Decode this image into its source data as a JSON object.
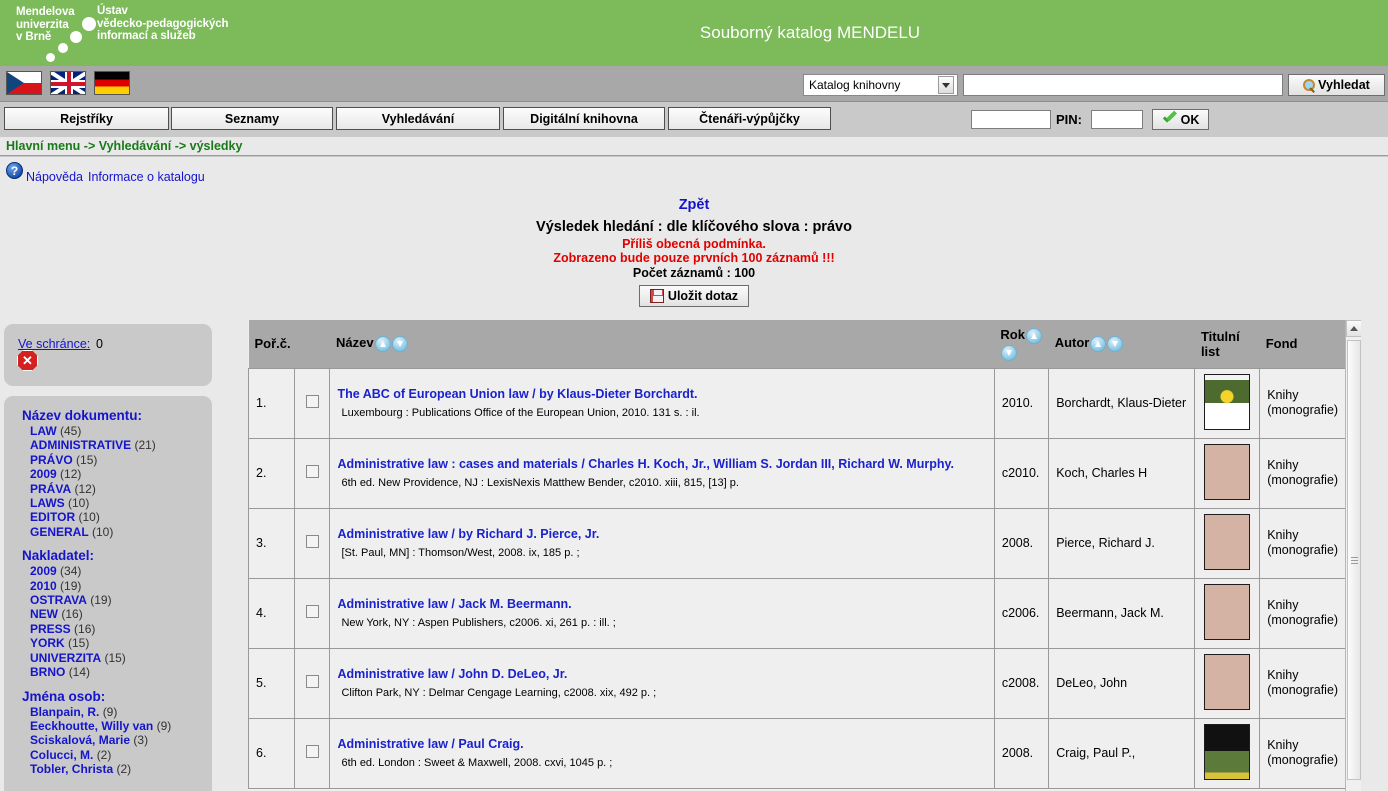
{
  "banner": {
    "logo_line1": "Mendelova\nuniverzita\nv Brně",
    "logo_line2": "Ústav\nvědecko-pedagogických\ninformací a služeb",
    "title": "Souborný katalog MENDELU"
  },
  "toolbar": {
    "flags": [
      "cz-flag-icon",
      "uk-flag-icon",
      "de-flag-icon"
    ],
    "search_scope_selected": "Katalog knihovny",
    "search_value": "",
    "search_placeholder": "",
    "search_button": "Vyhledat",
    "search_icon": "magnifier-icon",
    "user_value": "",
    "pin_label": "PIN:",
    "pin_value": "",
    "ok_button": "OK",
    "ok_icon": "check-icon"
  },
  "nav": {
    "items": [
      {
        "label": "Rejstříky"
      },
      {
        "label": "Seznamy"
      },
      {
        "label": "Vyhledávání"
      },
      {
        "label": "Digitální knihovna"
      },
      {
        "label": "Čtenáři-výpůjčky"
      }
    ]
  },
  "breadcrumb": {
    "text": "Hlavní menu -> Vyhledávání -> výsledky"
  },
  "help": {
    "icon": "question-mark-icon",
    "glyph": "?",
    "link1": "Nápověda",
    "link2": "Informace o katalogu"
  },
  "result_header": {
    "back_link": "Zpět",
    "title": "Výsledek hledání : dle klíčového slova : právo",
    "warning1": "Příliš obecná podmínka.",
    "warning2": "Zobrazeno bude pouze prvních 100 záznamů !!!",
    "count": "Počet záznamů : 100",
    "save_button": "Uložit dotaz",
    "save_icon": "floppy-disk-icon"
  },
  "clipboard": {
    "label": "Ve schránce:",
    "count": "0",
    "clear_icon": "red-x-delete-icon",
    "clear_glyph": "✕"
  },
  "facets": [
    {
      "heading": "Název dokumentu:",
      "items": [
        {
          "term": "LAW",
          "count": "(45)"
        },
        {
          "term": "ADMINISTRATIVE",
          "count": "(21)"
        },
        {
          "term": "PRÁVO",
          "count": "(15)"
        },
        {
          "term": "2009",
          "count": "(12)"
        },
        {
          "term": "PRÁVA",
          "count": "(12)"
        },
        {
          "term": "LAWS",
          "count": "(10)"
        },
        {
          "term": "EDITOR",
          "count": "(10)"
        },
        {
          "term": "GENERAL",
          "count": "(10)"
        }
      ]
    },
    {
      "heading": "Nakladatel:",
      "items": [
        {
          "term": "2009",
          "count": "(34)"
        },
        {
          "term": "2010",
          "count": "(19)"
        },
        {
          "term": "OSTRAVA",
          "count": "(19)"
        },
        {
          "term": "NEW",
          "count": "(16)"
        },
        {
          "term": "PRESS",
          "count": "(16)"
        },
        {
          "term": "YORK",
          "count": "(15)"
        },
        {
          "term": "UNIVERZITA",
          "count": "(15)"
        },
        {
          "term": "BRNO",
          "count": "(14)"
        }
      ]
    },
    {
      "heading": "Jména osob:",
      "items": [
        {
          "term": "Blanpain, R.",
          "count": "(9)"
        },
        {
          "term": "Eeckhoutte, Willy van",
          "count": "(9)"
        },
        {
          "term": "Sciskalová, Marie",
          "count": "(3)"
        },
        {
          "term": "Colucci, M.",
          "count": "(2)"
        },
        {
          "term": "Tobler, Christa",
          "count": "(2)"
        }
      ]
    }
  ],
  "table": {
    "columns": {
      "num": "Poř.č.",
      "title": "Název",
      "year": "Rok",
      "author": "Autor",
      "cover": "Titulní list",
      "fond": "Fond"
    },
    "sort_icons": {
      "up": "sort-ascending-icon",
      "down": "sort-descending-icon"
    },
    "rows": [
      {
        "num": "1.",
        "title": "The ABC of European Union law / by Klaus-Dieter Borchardt.",
        "sub": "Luxembourg : Publications Office of the European Union, 2010.  131 s. : il.",
        "year": "2010.",
        "author": "Borchardt, Klaus-Dieter",
        "cover": "book-cover-thumbnail",
        "fond": "Knihy (monografie)"
      },
      {
        "num": "2.",
        "title": "Administrative law : cases and materials / Charles H. Koch, Jr., William S. Jordan III, Richard W. Murphy.",
        "sub": "6th ed.  New Providence, NJ : LexisNexis Matthew Bender, c2010.  xiii, 815, [13] p.",
        "year": "c2010.",
        "author": "Koch, Charles H",
        "cover": "placeholder-cover",
        "fond": "Knihy (monografie)"
      },
      {
        "num": "3.",
        "title": "Administrative law / by Richard J. Pierce, Jr.",
        "sub": "[St. Paul, MN] : Thomson/West, 2008.  ix, 185 p. ;",
        "year": "2008.",
        "author": "Pierce, Richard J.",
        "cover": "placeholder-cover",
        "fond": "Knihy (monografie)"
      },
      {
        "num": "4.",
        "title": "Administrative law / Jack M. Beermann.",
        "sub": "New York, NY : Aspen Publishers, c2006.  xi, 261 p. : ill. ;",
        "year": "c2006.",
        "author": "Beermann, Jack M.",
        "cover": "placeholder-cover",
        "fond": "Knihy (monografie)"
      },
      {
        "num": "5.",
        "title": "Administrative law / John D. DeLeo, Jr.",
        "sub": "Clifton Park, NY : Delmar Cengage Learning, c2008.  xix, 492 p. ;",
        "year": "c2008.",
        "author": "DeLeo, John",
        "cover": "placeholder-cover",
        "fond": "Knihy (monografie)"
      },
      {
        "num": "6.",
        "title": "Administrative law / Paul Craig.",
        "sub": "6th ed.  London : Sweet & Maxwell, 2008.  cxvi, 1045 p. ;",
        "year": "2008.",
        "author": "Craig, Paul P.,",
        "cover": "book-cover-thumbnail-2",
        "fond": "Knihy (monografie)"
      }
    ]
  },
  "colors": {
    "brand_green": "#7cba5a",
    "link_blue": "#1414cc",
    "warning_red": "#e00000",
    "crumb_green": "#1a7a1a"
  }
}
